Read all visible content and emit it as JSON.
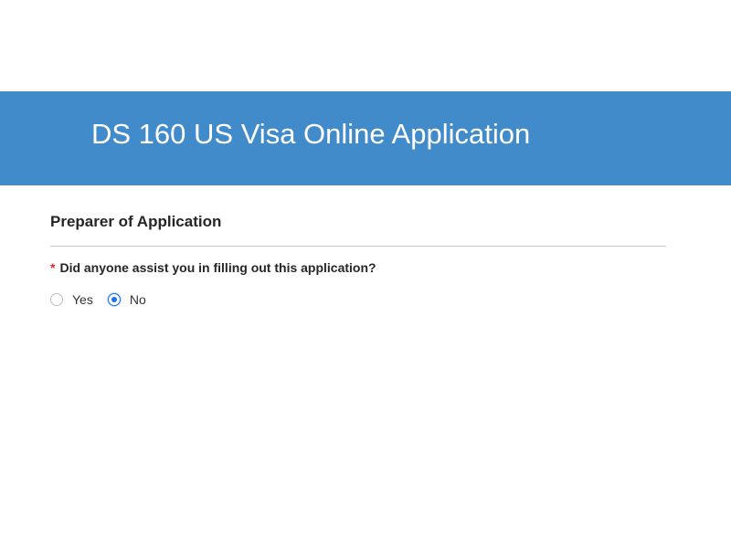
{
  "header": {
    "title": "DS 160 US Visa Online Application"
  },
  "section": {
    "title": "Preparer of Application",
    "question": {
      "required_mark": "*",
      "text": "Did anyone assist you in filling out this application?",
      "options": [
        {
          "label": "Yes",
          "selected": false
        },
        {
          "label": "No",
          "selected": true
        }
      ]
    }
  },
  "colors": {
    "banner": "#428bca",
    "required": "#d32f2f",
    "radio_selected": "#1a73e8"
  }
}
